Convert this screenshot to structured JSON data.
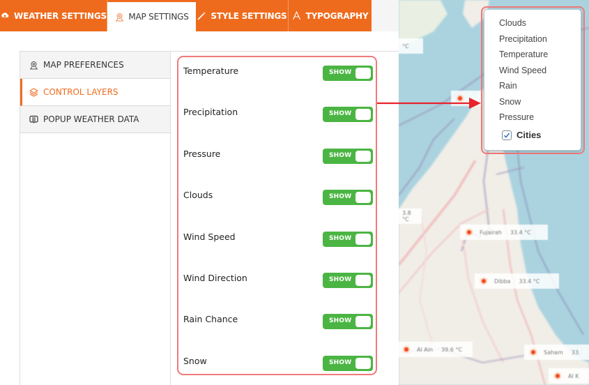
{
  "tabs": [
    {
      "label": "WEATHER SETTINGS",
      "icon": "gear-cloud-icon",
      "active": false
    },
    {
      "label": "MAP SETTINGS",
      "icon": "map-pin-icon",
      "active": true
    },
    {
      "label": "STYLE SETTINGS",
      "icon": "magic-wand-icon",
      "active": false
    },
    {
      "label": "TYPOGRAPHY",
      "icon": "typography-icon",
      "active": false
    }
  ],
  "subnav": [
    {
      "label": "MAP PREFERENCES",
      "icon": "map-pin-icon",
      "active": false
    },
    {
      "label": "CONTROL LAYERS",
      "icon": "layers-icon",
      "active": true
    },
    {
      "label": "POPUP WEATHER DATA",
      "icon": "popup-icon",
      "active": false
    }
  ],
  "layers": [
    {
      "label": "Temperature",
      "toggle": "SHOW",
      "enabled": true
    },
    {
      "label": "Precipitation",
      "toggle": "SHOW",
      "enabled": true
    },
    {
      "label": "Pressure",
      "toggle": "SHOW",
      "enabled": true
    },
    {
      "label": "Clouds",
      "toggle": "SHOW",
      "enabled": true
    },
    {
      "label": "Wind Speed",
      "toggle": "SHOW",
      "enabled": true
    },
    {
      "label": "Wind Direction",
      "toggle": "SHOW",
      "enabled": true
    },
    {
      "label": "Rain Chance",
      "toggle": "SHOW",
      "enabled": true
    },
    {
      "label": "Snow",
      "toggle": "SHOW",
      "enabled": true
    }
  ],
  "layer_control": {
    "items": [
      "Clouds",
      "Precipitation",
      "Temperature",
      "Wind Speed",
      "Rain",
      "Snow",
      "Pressure"
    ],
    "cities_label": "Cities",
    "cities_checked": true
  },
  "map": {
    "city_labels": [
      {
        "name": "Fujairah",
        "temp": "33.4 °C"
      },
      {
        "name": "Dibba",
        "temp": "33.4 °C"
      },
      {
        "name": "Al Ain",
        "temp": "39.6 °C"
      },
      {
        "name": "Saham",
        "temp": "33."
      },
      {
        "name": "",
        "temp": "°C"
      },
      {
        "name": "",
        "temp": "3.8 °C"
      },
      {
        "name": "Al K",
        "temp": ""
      }
    ]
  },
  "colors": {
    "accent": "#ee6b1d",
    "toggle_on": "#4bb543",
    "highlight": "#f07a7a",
    "arrow": "#e8232a"
  }
}
